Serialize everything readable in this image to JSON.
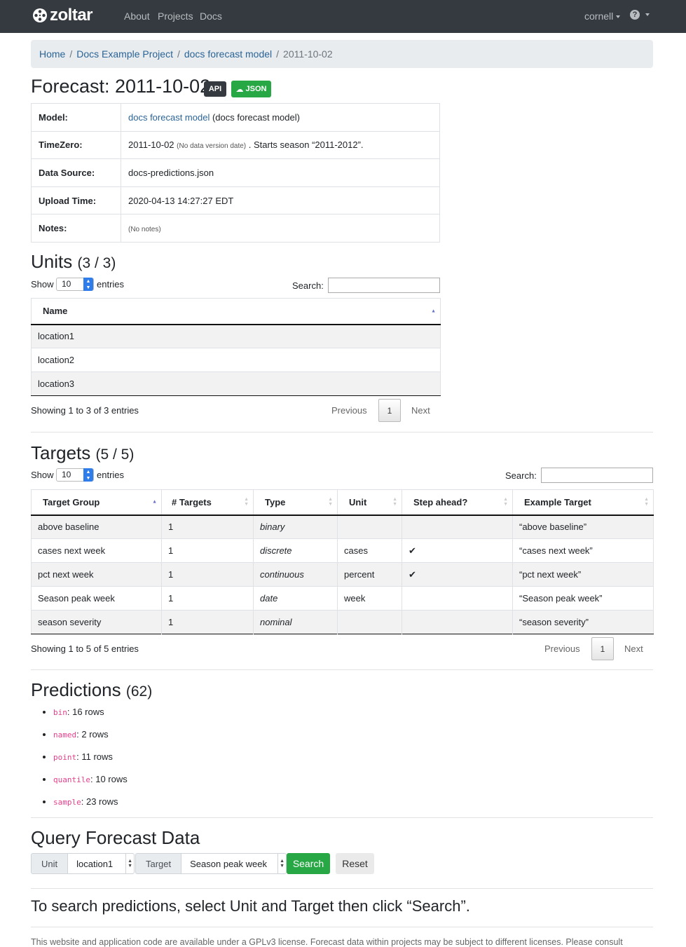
{
  "nav": {
    "brand": "zoltar",
    "links": [
      "About",
      "Projects",
      "Docs"
    ],
    "user": "cornell"
  },
  "breadcrumb": [
    "Home",
    "Docs Example Project",
    "docs forecast model",
    "2011-10-02"
  ],
  "title": "Forecast: 2011-10-02",
  "badges": {
    "api": "API",
    "json": "JSON"
  },
  "info": {
    "model_key": "Model:",
    "model_link": "docs forecast model",
    "model_extra": " (docs forecast model)",
    "timezero_key": "TimeZero:",
    "timezero_date": "2011-10-02",
    "timezero_note": "(No data version date)",
    "timezero_season": ". Starts season “2011-2012”.",
    "source_key": "Data Source:",
    "source_val": "docs-predictions.json",
    "upload_key": "Upload Time:",
    "upload_val": "2020-04-13 14:27:27 EDT",
    "notes_key": "Notes:",
    "notes_val": "(No notes)"
  },
  "units": {
    "heading": "Units",
    "count": "(3 / 3)",
    "show": "Show",
    "page_len": "10",
    "entries": "entries",
    "search_label": "Search:",
    "column": "Name",
    "rows": [
      "location1",
      "location2",
      "location3"
    ],
    "info": "Showing 1 to 3 of 3 entries",
    "prev": "Previous",
    "page": "1",
    "next": "Next"
  },
  "targets": {
    "heading": "Targets",
    "count": "(5 / 5)",
    "show": "Show",
    "page_len": "10",
    "entries": "entries",
    "search_label": "Search:",
    "columns": [
      "Target Group",
      "# Targets",
      "Type",
      "Unit",
      "Step ahead?",
      "Example Target"
    ],
    "rows": [
      {
        "group": "above baseline",
        "n": "1",
        "type": "binary",
        "unit": "",
        "step": "",
        "example": "“above baseline”"
      },
      {
        "group": "cases next week",
        "n": "1",
        "type": "discrete",
        "unit": "cases",
        "step": "✔",
        "example": "“cases next week”"
      },
      {
        "group": "pct next week",
        "n": "1",
        "type": "continuous",
        "unit": "percent",
        "step": "✔",
        "example": "“pct next week”"
      },
      {
        "group": "Season peak week",
        "n": "1",
        "type": "date",
        "unit": "week",
        "step": "",
        "example": "“Season peak week”"
      },
      {
        "group": "season severity",
        "n": "1",
        "type": "nominal",
        "unit": "",
        "step": "",
        "example": "“season severity”"
      }
    ],
    "info": "Showing 1 to 5 of 5 entries",
    "prev": "Previous",
    "page": "1",
    "next": "Next"
  },
  "predictions": {
    "heading": "Predictions",
    "count": "(62)",
    "items": [
      {
        "type": "bin",
        "rows": ": 16 rows"
      },
      {
        "type": "named",
        "rows": ": 2 rows"
      },
      {
        "type": "point",
        "rows": ": 11 rows"
      },
      {
        "type": "quantile",
        "rows": ": 10 rows"
      },
      {
        "type": "sample",
        "rows": ": 23 rows"
      }
    ]
  },
  "query": {
    "heading": "Query Forecast Data",
    "unit_label": "Unit",
    "unit_value": "location1",
    "target_label": "Target",
    "target_value": "Season peak week",
    "search_btn": "Search",
    "reset_btn": "Reset",
    "message": "To search predictions, select Unit and Target then click “Search”."
  },
  "footer": "This website and application code are available under a GPLv3 license. Forecast data within projects may be subject to different licenses. Please consult"
}
